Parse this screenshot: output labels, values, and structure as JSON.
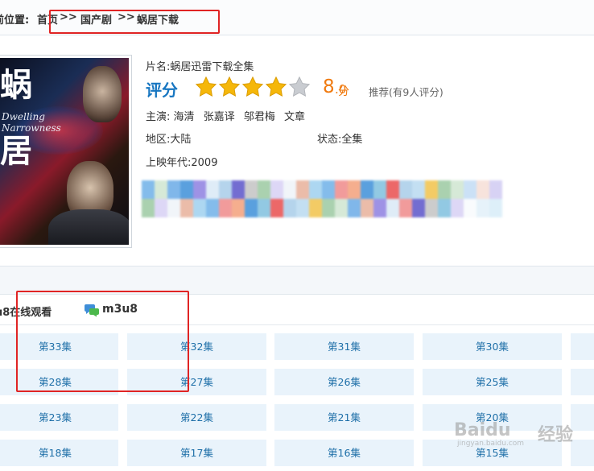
{
  "breadcrumb": {
    "prefix": "前位置:",
    "home": "首页",
    "sep1": ">>",
    "category": "国产剧",
    "sep2": ">>",
    "current": "蜗居下载"
  },
  "poster": {
    "title_char_1": "蜗",
    "title_char_2": "居",
    "english_line_1": "Dwelling",
    "english_line_2": "Narrowness"
  },
  "movie": {
    "name_label": "片名:",
    "name": "蜗居迅雷下载全集",
    "rating_label": "评分",
    "stars_filled": 4,
    "stars_total": 5,
    "score_int": "8",
    "score_dec": ".0",
    "score_unit": "分",
    "recommend": "推荐(有9人评分)",
    "cast_label": "主演:",
    "cast": [
      "海清",
      "张嘉译",
      "邬君梅",
      "文章"
    ],
    "region_label": "地区:",
    "region": "大陆",
    "status_label": "状态:",
    "status": "全集",
    "year_label": "上映年代:",
    "year": "2009"
  },
  "section": {
    "title": "u8在线观看",
    "source_label": "m3u8",
    "source_icon": "chat-bubble-icon"
  },
  "episodes": [
    [
      "第33集",
      "第32集",
      "第31集",
      "第30集"
    ],
    [
      "第28集",
      "第27集",
      "第26集",
      "第25集"
    ],
    [
      "第23集",
      "第22集",
      "第21集",
      "第20集"
    ],
    [
      "第18集",
      "第17集",
      "第16集",
      "第15集"
    ]
  ],
  "watermark": {
    "brand": "Baidu",
    "cn": "经验",
    "url": "jingyan.baidu.com"
  },
  "colors": {
    "accent_blue": "#1776c1",
    "score_orange": "#f07a0f",
    "episode_bg": "#e9f3fb",
    "episode_text": "#1e6fa8",
    "annotation_red": "#e02424",
    "star_gold": "#f5b70a"
  }
}
